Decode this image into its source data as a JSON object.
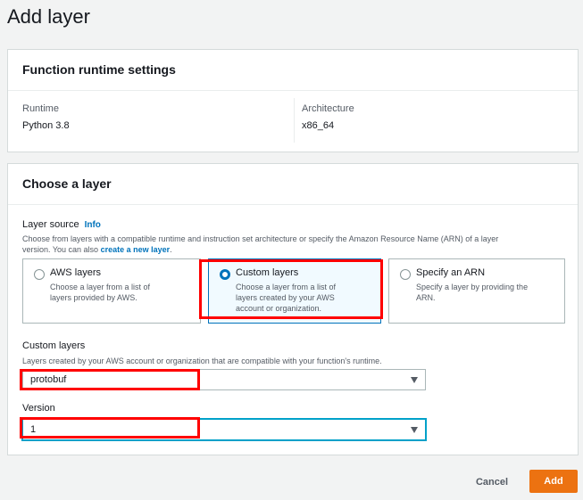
{
  "page": {
    "title": "Add layer"
  },
  "runtime_settings": {
    "header": "Function runtime settings",
    "runtime_label": "Runtime",
    "runtime_value": "Python 3.8",
    "architecture_label": "Architecture",
    "architecture_value": "x86_64"
  },
  "choose_layer": {
    "header": "Choose a layer",
    "source_label": "Layer source",
    "info_link": "Info",
    "description_line1": "Choose from layers with a compatible runtime and instruction set architecture or specify the Amazon Resource Name (ARN) of a layer",
    "description_line2_prefix": "version. You can also ",
    "description_link": "create a new layer",
    "description_line2_suffix": ".",
    "options": [
      {
        "title": "AWS layers",
        "desc_line1": "Choose a layer from a list of",
        "desc_line2": "layers provided by AWS.",
        "desc_line3": "",
        "selected": false
      },
      {
        "title": "Custom layers",
        "desc_line1": "Choose a layer from a list of",
        "desc_line2": "layers created by your AWS",
        "desc_line3": "account or organization.",
        "selected": true
      },
      {
        "title": "Specify an ARN",
        "desc_line1": "Specify a layer by providing the",
        "desc_line2": "ARN.",
        "desc_line3": "",
        "selected": false
      }
    ],
    "custom_layers": {
      "label": "Custom layers",
      "description": "Layers created by your AWS account or organization that are compatible with your function's runtime.",
      "value": "protobuf"
    },
    "version": {
      "label": "Version",
      "value": "1"
    }
  },
  "footer": {
    "cancel_label": "Cancel",
    "add_label": "Add"
  },
  "colors": {
    "accent": "#0073bb",
    "primary_button": "#ec7211",
    "highlight": "#ff0000"
  }
}
